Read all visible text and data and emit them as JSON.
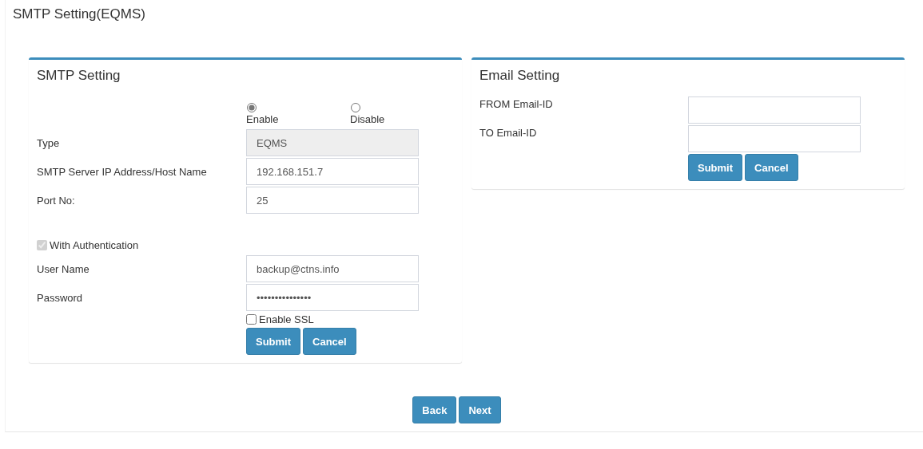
{
  "page_title": "SMTP Setting(EQMS)",
  "smtp_setting": {
    "title": "SMTP Setting",
    "mode_options": [
      {
        "label": "Enable",
        "selected": true
      },
      {
        "label": "Disable",
        "selected": false
      }
    ],
    "fields": [
      {
        "label": "Type",
        "value": "EQMS",
        "disabled": true
      },
      {
        "label": "SMTP Server IP Address/Host Name",
        "value": "192.168.151.7",
        "disabled": false
      },
      {
        "label": "Port No:",
        "value": "25",
        "disabled": false
      }
    ],
    "authentication": {
      "label": "With Authentication",
      "checked": true,
      "disabled": true
    },
    "auth_fields": [
      {
        "label": "User Name",
        "value": "backup@ctns.info",
        "disabled": false
      },
      {
        "label": "Password",
        "value": "•••••••••••••••",
        "disabled": false
      }
    ],
    "ssl": {
      "label": "Enable SSL",
      "checked": false,
      "disabled": false
    },
    "buttons": [
      "Submit",
      "Cancel"
    ]
  },
  "email_setting": {
    "title": "Email Setting",
    "fields": [
      {
        "label": "FROM Email-ID"
      },
      {
        "label": "TO Email-ID"
      }
    ],
    "buttons": [
      "Submit",
      "Cancel"
    ]
  },
  "nav_buttons": [
    "Back",
    "Next"
  ]
}
